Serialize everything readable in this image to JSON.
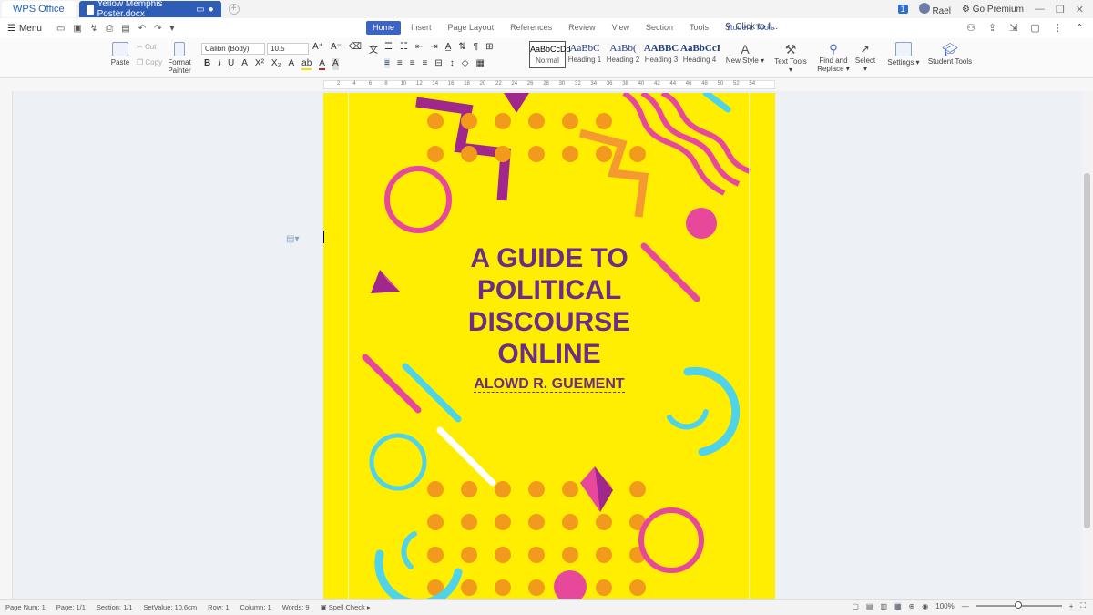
{
  "titlebar": {
    "app_tab": "WPS Office",
    "doc_tab": "Yellow Memphis Poster.docx",
    "notification_count": "1",
    "user": "Rael",
    "premium": "Go Premium"
  },
  "menubar": {
    "menu_label": "Menu",
    "tabs": [
      "Home",
      "Insert",
      "Page Layout",
      "References",
      "Review",
      "View",
      "Section",
      "Tools",
      "Student Tools"
    ],
    "search_placeholder": "Click to f..."
  },
  "ribbon": {
    "paste": "Paste",
    "cut": "Cut",
    "copy": "Copy",
    "format_painter": "Format Painter",
    "font_name": "Calibri (Body)",
    "font_size": "10.5",
    "styles": [
      {
        "preview": "AaBbCcDd",
        "label": "Normal"
      },
      {
        "preview": "AaBbC",
        "label": "Heading 1"
      },
      {
        "preview": "AaBb(",
        "label": "Heading 2"
      },
      {
        "preview": "AABBC",
        "label": "Heading 3"
      },
      {
        "preview": "AaBbCcI",
        "label": "Heading 4"
      }
    ],
    "new_style": "New Style",
    "text_tools": "Text Tools",
    "find_replace": "Find and Replace",
    "select": "Select",
    "settings": "Settings",
    "student_tools": "Student Tools"
  },
  "ruler": {
    "marks": [
      "2",
      "4",
      "6",
      "8",
      "10",
      "12",
      "14",
      "16",
      "18",
      "20",
      "22",
      "24",
      "26",
      "28",
      "30",
      "32",
      "34",
      "36",
      "38",
      "40",
      "42",
      "44",
      "46",
      "48",
      "50",
      "52",
      "54"
    ]
  },
  "document": {
    "title_lines": [
      "A GUIDE TO",
      "POLITICAL",
      "DISCOURSE",
      "ONLINE"
    ],
    "author": "ALOWD R. GUEMENT",
    "colors": {
      "background": "#ffee00",
      "text": "#6b2d86",
      "magenta": "#e8489c",
      "purple": "#a0288c",
      "orange": "#f29a1b",
      "cyan": "#4fd3e8",
      "white": "#ffffff"
    }
  },
  "statusbar": {
    "page_num": "Page Num: 1",
    "page": "Page: 1/1",
    "section": "Section: 1/1",
    "set_value": "SetValue: 10.6cm",
    "row": "Row: 1",
    "column": "Column: 1",
    "words": "Words: 9",
    "spell_check": "Spell Check",
    "zoom": "100%"
  }
}
